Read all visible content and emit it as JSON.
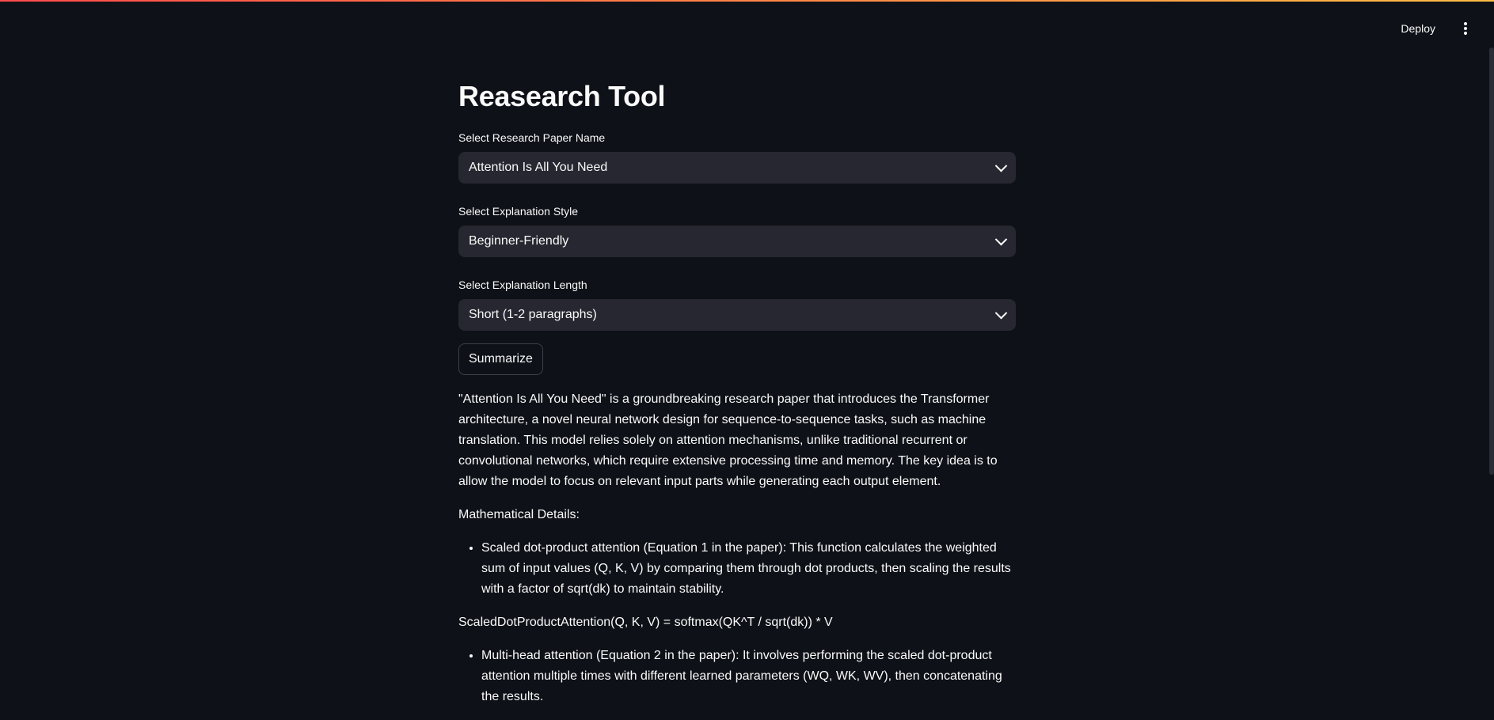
{
  "header": {
    "deploy_label": "Deploy",
    "menu_icon": "vertical-ellipsis-icon"
  },
  "main": {
    "title": "Reasearch Tool",
    "paper_select": {
      "label": "Select Research Paper Name",
      "value": "Attention Is All You Need"
    },
    "style_select": {
      "label": "Select Explanation Style",
      "value": "Beginner-Friendly"
    },
    "length_select": {
      "label": "Select Explanation Length",
      "value": "Short (1-2 paragraphs)"
    },
    "summarize_label": "Summarize"
  },
  "output": {
    "intro": "\"Attention Is All You Need\" is a groundbreaking research paper that introduces the Transformer architecture, a novel neural network design for sequence-to-sequence tasks, such as machine translation. This model relies solely on attention mechanisms, unlike traditional recurrent or convolutional networks, which require extensive processing time and memory. The key idea is to allow the model to focus on relevant input parts while generating each output element.",
    "math_heading": "Mathematical Details:",
    "bullet1": "Scaled dot-product attention (Equation 1 in the paper): This function calculates the weighted sum of input values (Q, K, V) by comparing them through dot products, then scaling the results with a factor of sqrt(dk) to maintain stability.",
    "formula1": "ScaledDotProductAttention(Q, K, V) = softmax(QK^T / sqrt(dk)) * V",
    "bullet2": "Multi-head attention (Equation 2 in the paper): It involves performing the scaled dot-product attention multiple times with different learned parameters (WQ, WK, WV), then concatenating the results."
  }
}
